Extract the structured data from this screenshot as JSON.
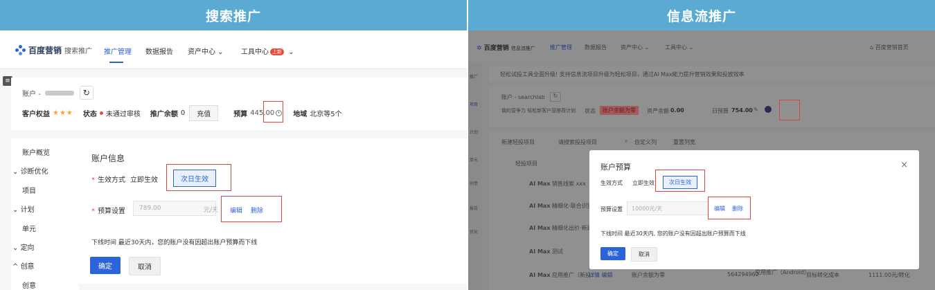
{
  "left": {
    "banner": "搜索推广",
    "nav": {
      "logo": "百度营销",
      "logo_sub": "搜索推广",
      "items": [
        "推广管理",
        "数据报告",
        "资产中心 ⌄",
        "工具中心"
      ],
      "badge": "上新",
      "badge_caret": "⌄"
    },
    "account": {
      "label": "账户 -",
      "rights_label": "客户权益",
      "stars": "★★★",
      "status_label": "状态",
      "status_value": "未通过审核",
      "balance_label": "推广余额",
      "balance_value": "0",
      "charge": "充值",
      "budget_label": "预算",
      "budget_value": "445.00",
      "region_label": "地域",
      "region_value": "北京等5个"
    },
    "menu": [
      "账户概览",
      "诊断优化",
      "项目",
      "计划",
      "单元",
      "定向",
      "创意",
      "创意"
    ],
    "form": {
      "title": "账户信息",
      "effect_label": "生效方式",
      "effect_opt1": "立即生效",
      "effect_opt2": "次日生效",
      "budget_label": "预算设置",
      "budget_value": "789.00",
      "budget_unit": "元/天",
      "edit": "编辑",
      "delete": "删除",
      "note": "下线时间  最近30天内，您的账户没有因超出账户预算而下线",
      "confirm": "确定",
      "cancel": "取消"
    }
  },
  "right": {
    "banner": "信息流推广",
    "nav": {
      "logo": "百度营销",
      "logo_sub": "信息流推广",
      "items": [
        "推广管理",
        "数据报告",
        "资产中心 ⌄",
        "工具中心 ⌄"
      ],
      "right_item": "百度营销首页"
    },
    "tip": "轻松试投工具全面升级! 支持信息流项目升级为轻松项目，通过AI Max能力提升营销效果和投放效率",
    "account": {
      "label": "账户 - searchlab",
      "desc": "我的营争力  轻松新客户营推荐计划",
      "status_label": "状态",
      "status_value": "账户余额为零",
      "balance_label": "资产余额",
      "balance_value": "0.00",
      "budget_label": "日预算",
      "budget_value": "754.00"
    },
    "toolbar": {
      "new": "新建轻投项目",
      "search": "请搜索投投项目",
      "custom": "自定义列",
      "reset": "重置列宽"
    },
    "header_col": "轻投项目",
    "sidebar": [
      "推广",
      "项目",
      "计划",
      "单元",
      "创意",
      "报告",
      "优化"
    ],
    "rows": [
      {
        "tag": "AI Max",
        "name": "销售线索 xxx"
      },
      {
        "tag": "AI Max",
        "name": "精细化·联合识别"
      },
      {
        "tag": "AI Max",
        "name": "精细化出价·新建..."
      },
      {
        "tag": "AI Max",
        "name": "测试"
      },
      {
        "tag": "AI Max",
        "name": "应用推广（新投..."
      }
    ],
    "last_row": {
      "links": "详情 编辑",
      "status": "账户余额为零",
      "id": "564294962",
      "promo": "应用推广（Android）",
      "target": "目标转化成本",
      "price": "1111.00元/转化"
    },
    "modal": {
      "title": "账户预算",
      "close": "×",
      "effect_label": "生效方式",
      "effect_opt1": "立即生效",
      "effect_opt2": "次日生效",
      "budget_label": "预算设置",
      "budget_placeholder": "10000元/天",
      "edit": "编辑",
      "delete": "删除",
      "note": "下线时间  最近30天内, 您的账户没有因超出账户预算而下线",
      "confirm": "确定",
      "cancel": "取消"
    }
  },
  "colors": {
    "banner": "#5aaad4",
    "accent": "#2d63d8",
    "highlight": "#d84545"
  }
}
